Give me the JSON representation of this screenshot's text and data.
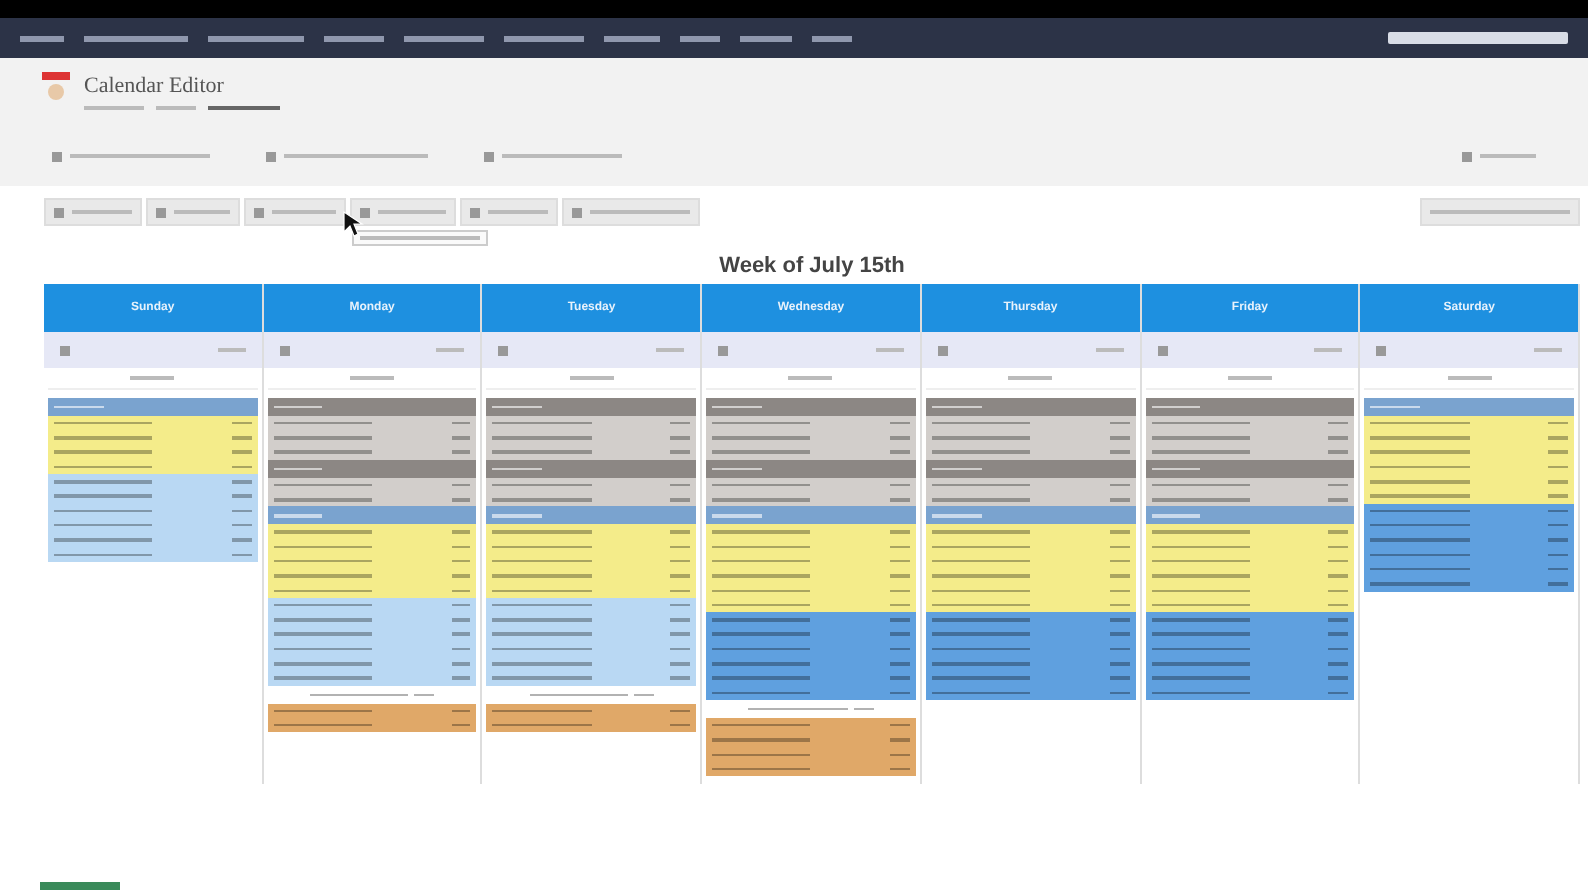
{
  "window": {
    "title": "Calendar Editor"
  },
  "heading": "Week of July 15th",
  "days": [
    {
      "name": "Sunday",
      "entries": [
        {
          "kind": "header",
          "color": "#7aa3cf"
        },
        {
          "kind": "row",
          "color": "#f4ec8a"
        },
        {
          "kind": "row",
          "color": "#f4ec8a"
        },
        {
          "kind": "row",
          "color": "#f4ec8a"
        },
        {
          "kind": "row",
          "color": "#f4ec8a"
        },
        {
          "kind": "row",
          "color": "#b9d8f3"
        },
        {
          "kind": "row",
          "color": "#b9d8f3"
        },
        {
          "kind": "row",
          "color": "#b9d8f3"
        },
        {
          "kind": "row",
          "color": "#b9d8f3"
        },
        {
          "kind": "row",
          "color": "#b9d8f3"
        },
        {
          "kind": "row",
          "color": "#b9d8f3"
        }
      ]
    },
    {
      "name": "Monday",
      "entries": [
        {
          "kind": "header",
          "color": "#8c8784"
        },
        {
          "kind": "row",
          "color": "#d2cecb"
        },
        {
          "kind": "row",
          "color": "#d2cecb"
        },
        {
          "kind": "row",
          "color": "#d2cecb"
        },
        {
          "kind": "header",
          "color": "#8c8784"
        },
        {
          "kind": "row",
          "color": "#d2cecb"
        },
        {
          "kind": "row",
          "color": "#d2cecb"
        },
        {
          "kind": "header",
          "color": "#7aa3cf"
        },
        {
          "kind": "row",
          "color": "#f4ec8a"
        },
        {
          "kind": "row",
          "color": "#f4ec8a"
        },
        {
          "kind": "row",
          "color": "#f4ec8a"
        },
        {
          "kind": "row",
          "color": "#f4ec8a"
        },
        {
          "kind": "row",
          "color": "#f4ec8a"
        },
        {
          "kind": "row",
          "color": "#b9d8f3"
        },
        {
          "kind": "row",
          "color": "#b9d8f3"
        },
        {
          "kind": "row",
          "color": "#b9d8f3"
        },
        {
          "kind": "row",
          "color": "#b9d8f3"
        },
        {
          "kind": "row",
          "color": "#b9d8f3"
        },
        {
          "kind": "row",
          "color": "#b9d8f3"
        },
        {
          "kind": "label",
          "color": "#ffffff"
        },
        {
          "kind": "row",
          "color": "#e0a868"
        },
        {
          "kind": "row",
          "color": "#e0a868"
        }
      ]
    },
    {
      "name": "Tuesday",
      "entries": [
        {
          "kind": "header",
          "color": "#8c8784"
        },
        {
          "kind": "row",
          "color": "#d2cecb"
        },
        {
          "kind": "row",
          "color": "#d2cecb"
        },
        {
          "kind": "row",
          "color": "#d2cecb"
        },
        {
          "kind": "header",
          "color": "#8c8784"
        },
        {
          "kind": "row",
          "color": "#d2cecb"
        },
        {
          "kind": "row",
          "color": "#d2cecb"
        },
        {
          "kind": "header",
          "color": "#7aa3cf"
        },
        {
          "kind": "row",
          "color": "#f4ec8a"
        },
        {
          "kind": "row",
          "color": "#f4ec8a"
        },
        {
          "kind": "row",
          "color": "#f4ec8a"
        },
        {
          "kind": "row",
          "color": "#f4ec8a"
        },
        {
          "kind": "row",
          "color": "#f4ec8a"
        },
        {
          "kind": "row",
          "color": "#b9d8f3"
        },
        {
          "kind": "row",
          "color": "#b9d8f3"
        },
        {
          "kind": "row",
          "color": "#b9d8f3"
        },
        {
          "kind": "row",
          "color": "#b9d8f3"
        },
        {
          "kind": "row",
          "color": "#b9d8f3"
        },
        {
          "kind": "row",
          "color": "#b9d8f3"
        },
        {
          "kind": "label",
          "color": "#ffffff"
        },
        {
          "kind": "row",
          "color": "#e0a868"
        },
        {
          "kind": "row",
          "color": "#e0a868"
        }
      ]
    },
    {
      "name": "Wednesday",
      "entries": [
        {
          "kind": "header",
          "color": "#8c8784"
        },
        {
          "kind": "row",
          "color": "#d2cecb"
        },
        {
          "kind": "row",
          "color": "#d2cecb"
        },
        {
          "kind": "row",
          "color": "#d2cecb"
        },
        {
          "kind": "header",
          "color": "#8c8784"
        },
        {
          "kind": "row",
          "color": "#d2cecb"
        },
        {
          "kind": "row",
          "color": "#d2cecb"
        },
        {
          "kind": "header",
          "color": "#7aa3cf"
        },
        {
          "kind": "row",
          "color": "#f4ec8a"
        },
        {
          "kind": "row",
          "color": "#f4ec8a"
        },
        {
          "kind": "row",
          "color": "#f4ec8a"
        },
        {
          "kind": "row",
          "color": "#f4ec8a"
        },
        {
          "kind": "row",
          "color": "#f4ec8a"
        },
        {
          "kind": "row",
          "color": "#f4ec8a"
        },
        {
          "kind": "row",
          "color": "#5fa0df"
        },
        {
          "kind": "row",
          "color": "#5fa0df"
        },
        {
          "kind": "row",
          "color": "#5fa0df"
        },
        {
          "kind": "row",
          "color": "#5fa0df"
        },
        {
          "kind": "row",
          "color": "#5fa0df"
        },
        {
          "kind": "row",
          "color": "#5fa0df"
        },
        {
          "kind": "label",
          "color": "#ffffff"
        },
        {
          "kind": "row",
          "color": "#e0a868"
        },
        {
          "kind": "row",
          "color": "#e0a868"
        },
        {
          "kind": "row",
          "color": "#e0a868"
        },
        {
          "kind": "row",
          "color": "#e0a868"
        }
      ]
    },
    {
      "name": "Thursday",
      "entries": [
        {
          "kind": "header",
          "color": "#8c8784"
        },
        {
          "kind": "row",
          "color": "#d2cecb"
        },
        {
          "kind": "row",
          "color": "#d2cecb"
        },
        {
          "kind": "row",
          "color": "#d2cecb"
        },
        {
          "kind": "header",
          "color": "#8c8784"
        },
        {
          "kind": "row",
          "color": "#d2cecb"
        },
        {
          "kind": "row",
          "color": "#d2cecb"
        },
        {
          "kind": "header",
          "color": "#7aa3cf"
        },
        {
          "kind": "row",
          "color": "#f4ec8a"
        },
        {
          "kind": "row",
          "color": "#f4ec8a"
        },
        {
          "kind": "row",
          "color": "#f4ec8a"
        },
        {
          "kind": "row",
          "color": "#f4ec8a"
        },
        {
          "kind": "row",
          "color": "#f4ec8a"
        },
        {
          "kind": "row",
          "color": "#f4ec8a"
        },
        {
          "kind": "row",
          "color": "#5fa0df"
        },
        {
          "kind": "row",
          "color": "#5fa0df"
        },
        {
          "kind": "row",
          "color": "#5fa0df"
        },
        {
          "kind": "row",
          "color": "#5fa0df"
        },
        {
          "kind": "row",
          "color": "#5fa0df"
        },
        {
          "kind": "row",
          "color": "#5fa0df"
        }
      ]
    },
    {
      "name": "Friday",
      "entries": [
        {
          "kind": "header",
          "color": "#8c8784"
        },
        {
          "kind": "row",
          "color": "#d2cecb"
        },
        {
          "kind": "row",
          "color": "#d2cecb"
        },
        {
          "kind": "row",
          "color": "#d2cecb"
        },
        {
          "kind": "header",
          "color": "#8c8784"
        },
        {
          "kind": "row",
          "color": "#d2cecb"
        },
        {
          "kind": "row",
          "color": "#d2cecb"
        },
        {
          "kind": "header",
          "color": "#7aa3cf"
        },
        {
          "kind": "row",
          "color": "#f4ec8a"
        },
        {
          "kind": "row",
          "color": "#f4ec8a"
        },
        {
          "kind": "row",
          "color": "#f4ec8a"
        },
        {
          "kind": "row",
          "color": "#f4ec8a"
        },
        {
          "kind": "row",
          "color": "#f4ec8a"
        },
        {
          "kind": "row",
          "color": "#f4ec8a"
        },
        {
          "kind": "row",
          "color": "#5fa0df"
        },
        {
          "kind": "row",
          "color": "#5fa0df"
        },
        {
          "kind": "row",
          "color": "#5fa0df"
        },
        {
          "kind": "row",
          "color": "#5fa0df"
        },
        {
          "kind": "row",
          "color": "#5fa0df"
        },
        {
          "kind": "row",
          "color": "#5fa0df"
        }
      ]
    },
    {
      "name": "Saturday",
      "entries": [
        {
          "kind": "header",
          "color": "#7aa3cf"
        },
        {
          "kind": "row",
          "color": "#f4ec8a"
        },
        {
          "kind": "row",
          "color": "#f4ec8a"
        },
        {
          "kind": "row",
          "color": "#f4ec8a"
        },
        {
          "kind": "row",
          "color": "#f4ec8a"
        },
        {
          "kind": "row",
          "color": "#f4ec8a"
        },
        {
          "kind": "row",
          "color": "#f4ec8a"
        },
        {
          "kind": "row",
          "color": "#5fa0df"
        },
        {
          "kind": "row",
          "color": "#5fa0df"
        },
        {
          "kind": "row",
          "color": "#5fa0df"
        },
        {
          "kind": "row",
          "color": "#5fa0df"
        },
        {
          "kind": "row",
          "color": "#5fa0df"
        },
        {
          "kind": "row",
          "color": "#5fa0df"
        }
      ]
    }
  ]
}
